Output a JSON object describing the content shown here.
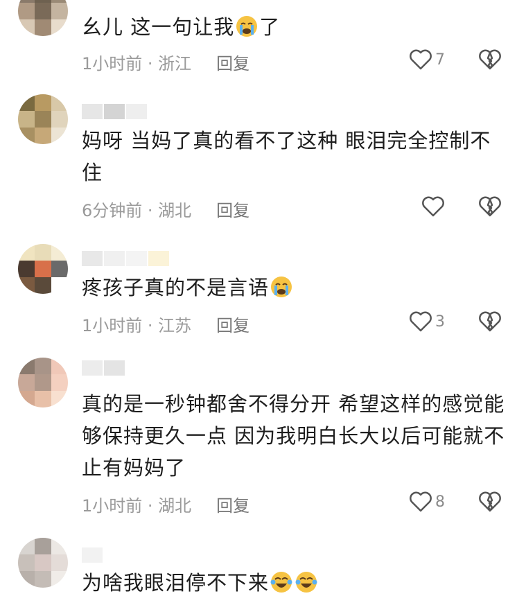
{
  "comments": [
    {
      "text": "幺儿 这一句让我",
      "emoji_after": "loudly-crying-face",
      "text_after": "了",
      "time": "1小时前",
      "location": "浙江",
      "reply": "回复",
      "likes": "7"
    },
    {
      "text": "妈呀 当妈了真的看不了这种 眼泪完全控制不住",
      "time": "6分钟前",
      "location": "湖北",
      "reply": "回复",
      "likes": ""
    },
    {
      "text": "疼孩子真的不是言语",
      "emoji_after": "loudly-crying-face",
      "time": "1小时前",
      "location": "江苏",
      "reply": "回复",
      "likes": "3"
    },
    {
      "text": "真的是一秒钟都舍不得分开 希望这样的感觉能够保持更久一点 因为我明白长大以后可能就不止有妈妈了",
      "time": "1小时前",
      "location": "湖北",
      "reply": "回复",
      "likes": "8"
    },
    {
      "text": "为啥我眼泪停不下来",
      "emoji_after": "tears-of-joy-face x2"
    }
  ],
  "colors": {
    "meta_text": "#9a9a9a",
    "icon_stroke": "#555555",
    "emoji_yellow": "#f6c343"
  }
}
